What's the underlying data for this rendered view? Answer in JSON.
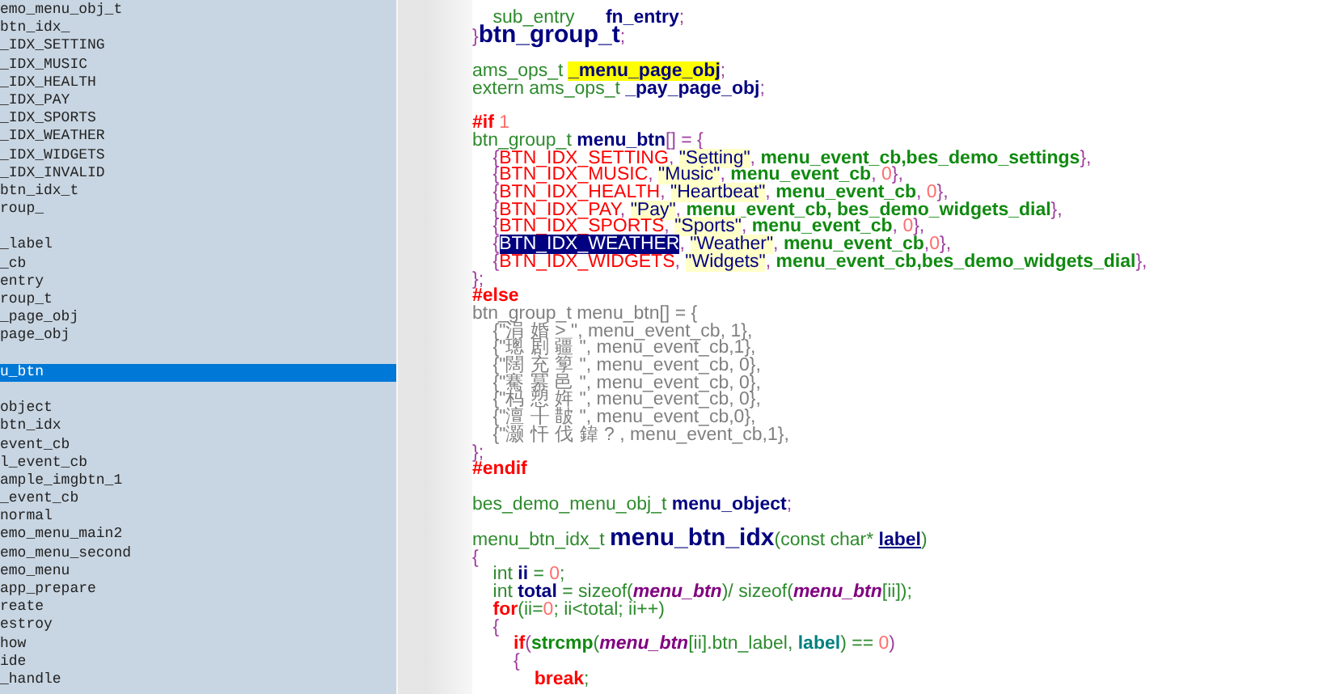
{
  "symbol_list": [
    {
      "text": "emo_menu_obj_t",
      "selected": false
    },
    {
      "text": "btn_idx_",
      "selected": false
    },
    {
      "text": "_IDX_SETTING",
      "selected": false
    },
    {
      "text": "_IDX_MUSIC",
      "selected": false
    },
    {
      "text": "_IDX_HEALTH",
      "selected": false
    },
    {
      "text": "_IDX_PAY",
      "selected": false
    },
    {
      "text": "_IDX_SPORTS",
      "selected": false
    },
    {
      "text": "_IDX_WEATHER",
      "selected": false
    },
    {
      "text": "_IDX_WIDGETS",
      "selected": false
    },
    {
      "text": "_IDX_INVALID",
      "selected": false
    },
    {
      "text": "btn_idx_t",
      "selected": false
    },
    {
      "text": "roup_",
      "selected": false
    },
    {
      "text": "_label",
      "selected": false,
      "space_before": true
    },
    {
      "text": "_cb",
      "selected": false
    },
    {
      "text": "entry",
      "selected": false
    },
    {
      "text": "roup_t",
      "selected": false
    },
    {
      "text": "_page_obj",
      "selected": false
    },
    {
      "text": "page_obj",
      "selected": false
    },
    {
      "text": "u_btn",
      "selected": true,
      "space_before": true
    },
    {
      "text": "object",
      "selected": false,
      "space_before": true
    },
    {
      "text": "btn_idx",
      "selected": false
    },
    {
      "text": "event_cb",
      "selected": false
    },
    {
      "text": "l_event_cb",
      "selected": false
    },
    {
      "text": "ample_imgbtn_1",
      "selected": false
    },
    {
      "text": "_event_cb",
      "selected": false
    },
    {
      "text": "normal",
      "selected": false
    },
    {
      "text": "emo_menu_main2",
      "selected": false
    },
    {
      "text": "emo_menu_second",
      "selected": false
    },
    {
      "text": "emo_menu",
      "selected": false
    },
    {
      "text": "app_prepare",
      "selected": false
    },
    {
      "text": "reate",
      "selected": false
    },
    {
      "text": "estroy",
      "selected": false
    },
    {
      "text": "how",
      "selected": false
    },
    {
      "text": "ide",
      "selected": false
    },
    {
      "text": "_handle",
      "selected": false
    }
  ],
  "code_lines": [
    {
      "tokens": [
        {
          "kind": "type",
          "text": "    sub_entry      "
        },
        {
          "kind": "name",
          "text": "fn_entry"
        },
        {
          "kind": "punct",
          "text": ";"
        }
      ]
    },
    {
      "tokens": [
        {
          "kind": "punct",
          "text": "}"
        },
        {
          "kind": "title",
          "text": "btn_group_t"
        },
        {
          "kind": "punct",
          "text": ";"
        }
      ]
    },
    {
      "space_before": true,
      "tokens": [
        {
          "kind": "type",
          "text": "ams_ops_t "
        },
        {
          "kind": "mark",
          "text": "_menu_page_obj"
        },
        {
          "kind": "punct",
          "text": ";"
        }
      ]
    },
    {
      "tokens": [
        {
          "kind": "type",
          "text": "extern ams_ops_t "
        },
        {
          "kind": "name",
          "text": "_pay_page_obj"
        },
        {
          "kind": "punct",
          "text": ";"
        }
      ]
    },
    {
      "space_before": true,
      "tokens": [
        {
          "kind": "kw",
          "text": "#if "
        },
        {
          "kind": "num",
          "text": "1"
        }
      ]
    },
    {
      "tokens": [
        {
          "kind": "type",
          "text": "btn_group_t "
        },
        {
          "kind": "name",
          "text": "menu_btn"
        },
        {
          "kind": "punct",
          "text": "[] = {"
        }
      ]
    },
    {
      "tokens": [
        {
          "kind": "punct",
          "text": "    {"
        },
        {
          "kind": "macro",
          "text": "BTN_IDX_SETTING"
        },
        {
          "kind": "punct",
          "text": ", "
        },
        {
          "kind": "str",
          "text": "\"Setting\""
        },
        {
          "kind": "punct",
          "text": ", "
        },
        {
          "kind": "func",
          "text": "menu_event_cb,bes_demo_settings"
        },
        {
          "kind": "punct",
          "text": "},"
        }
      ]
    },
    {
      "tokens": [
        {
          "kind": "punct",
          "text": "    {"
        },
        {
          "kind": "macro",
          "text": "BTN_IDX_MUSIC"
        },
        {
          "kind": "punct",
          "text": ", "
        },
        {
          "kind": "str",
          "text": "\"Music\""
        },
        {
          "kind": "punct",
          "text": ", "
        },
        {
          "kind": "func",
          "text": "menu_event_cb"
        },
        {
          "kind": "punct",
          "text": ", "
        },
        {
          "kind": "num",
          "text": "0"
        },
        {
          "kind": "punct",
          "text": "},"
        }
      ]
    },
    {
      "tokens": [
        {
          "kind": "punct",
          "text": "    {"
        },
        {
          "kind": "macro",
          "text": "BTN_IDX_HEALTH"
        },
        {
          "kind": "punct",
          "text": ", "
        },
        {
          "kind": "str",
          "text": "\"Heartbeat\""
        },
        {
          "kind": "punct",
          "text": ", "
        },
        {
          "kind": "func",
          "text": "menu_event_cb"
        },
        {
          "kind": "punct",
          "text": ", "
        },
        {
          "kind": "num",
          "text": "0"
        },
        {
          "kind": "punct",
          "text": "},"
        }
      ]
    },
    {
      "tokens": [
        {
          "kind": "punct",
          "text": "    {"
        },
        {
          "kind": "macro",
          "text": "BTN_IDX_PAY"
        },
        {
          "kind": "punct",
          "text": ", "
        },
        {
          "kind": "str",
          "text": "\"Pay\""
        },
        {
          "kind": "punct",
          "text": ", "
        },
        {
          "kind": "func",
          "text": "menu_event_cb, bes_demo_widgets_dial"
        },
        {
          "kind": "punct",
          "text": "},"
        }
      ]
    },
    {
      "tokens": [
        {
          "kind": "punct",
          "text": "    {"
        },
        {
          "kind": "macro",
          "text": "BTN_IDX_SPORTS"
        },
        {
          "kind": "punct",
          "text": ", "
        },
        {
          "kind": "str",
          "text": "\"Sports\""
        },
        {
          "kind": "punct",
          "text": ", "
        },
        {
          "kind": "func",
          "text": "menu_event_cb"
        },
        {
          "kind": "punct",
          "text": ", "
        },
        {
          "kind": "num",
          "text": "0"
        },
        {
          "kind": "punct",
          "text": "},"
        }
      ]
    },
    {
      "tokens": [
        {
          "kind": "punct",
          "text": "    {"
        },
        {
          "kind": "sel",
          "text": "BTN_IDX_WEATHER"
        },
        {
          "kind": "punct",
          "text": ", "
        },
        {
          "kind": "str",
          "text": "\"Weather\""
        },
        {
          "kind": "punct",
          "text": ", "
        },
        {
          "kind": "func",
          "text": "menu_event_cb"
        },
        {
          "kind": "punct",
          "text": ","
        },
        {
          "kind": "num",
          "text": "0"
        },
        {
          "kind": "punct",
          "text": "},"
        }
      ]
    },
    {
      "tokens": [
        {
          "kind": "punct",
          "text": "    {"
        },
        {
          "kind": "macro",
          "text": "BTN_IDX_WIDGETS"
        },
        {
          "kind": "punct",
          "text": ", "
        },
        {
          "kind": "str",
          "text": "\"Widgets\""
        },
        {
          "kind": "punct",
          "text": ", "
        },
        {
          "kind": "func",
          "text": "menu_event_cb,bes_demo_widgets_dial"
        },
        {
          "kind": "punct",
          "text": "},"
        }
      ]
    },
    {
      "tokens": [
        {
          "kind": "punct",
          "text": "};"
        }
      ]
    },
    {
      "tokens": [
        {
          "kind": "kw",
          "text": "#else"
        }
      ]
    },
    {
      "tokens": [
        {
          "kind": "gray",
          "text": "btn_group_t menu_btn[] = {"
        }
      ]
    },
    {
      "tokens": [
        {
          "kind": "gray",
          "text": "    {\"涓 婚 > \", menu_event_cb, 1},"
        }
      ]
    },
    {
      "tokens": [
        {
          "kind": "gray",
          "text": "    {\"璁 剧 疆 \", menu_event_cb,1},"
        }
      ]
    },
    {
      "tokens": [
        {
          "kind": "gray",
          "text": "    {\"闊 充 箰 \", menu_event_cb, 0},"
        }
      ]
    },
    {
      "tokens": [
        {
          "kind": "gray",
          "text": "    {\"騫 冪 邑 \", menu_event_cb, 0},"
        }
      ]
    },
    {
      "tokens": [
        {
          "kind": "gray",
          "text": "    {\"杩 愬 姩 \", menu_event_cb, 0},"
        }
      ]
    },
    {
      "tokens": [
        {
          "kind": "gray",
          "text": "    {\"澶 ╂ 皵 \", menu_event_cb,0},"
        }
      ]
    },
    {
      "tokens": [
        {
          "kind": "gray",
          "text": "    {\"灏 忓 伐 鍏 ? , menu_event_cb,1},"
        }
      ]
    },
    {
      "tokens": [
        {
          "kind": "punct",
          "text": "};"
        }
      ]
    },
    {
      "tokens": [
        {
          "kind": "kw",
          "text": "#endif"
        }
      ]
    },
    {
      "space_before": true,
      "tokens": [
        {
          "kind": "type",
          "text": "bes_demo_menu_obj_t "
        },
        {
          "kind": "name",
          "text": "menu_object"
        },
        {
          "kind": "punct",
          "text": ";"
        }
      ]
    },
    {
      "space_before": true,
      "tokens": [
        {
          "kind": "type",
          "text": "menu_btn_idx_t "
        },
        {
          "kind": "title",
          "text": "menu_btn_idx"
        },
        {
          "kind": "type",
          "text": "(const char* "
        },
        {
          "kind": "arg",
          "text": "label"
        },
        {
          "kind": "type",
          "text": ")"
        }
      ]
    },
    {
      "tokens": [
        {
          "kind": "punct",
          "text": "{"
        }
      ]
    },
    {
      "tokens": [
        {
          "kind": "type",
          "text": "    int "
        },
        {
          "kind": "name",
          "text": "ii"
        },
        {
          "kind": "type",
          "text": " = "
        },
        {
          "kind": "num",
          "text": "0"
        },
        {
          "kind": "type",
          "text": ";"
        }
      ]
    },
    {
      "tokens": [
        {
          "kind": "type",
          "text": "    int "
        },
        {
          "kind": "name",
          "text": "total"
        },
        {
          "kind": "type",
          "text": " = sizeof("
        },
        {
          "kind": "param",
          "text": "menu_btn"
        },
        {
          "kind": "type",
          "text": ")/ sizeof("
        },
        {
          "kind": "param",
          "text": "menu_btn"
        },
        {
          "kind": "type",
          "text": "[ii]);"
        }
      ]
    },
    {
      "tokens": [
        {
          "kind": "kw",
          "text": "    for"
        },
        {
          "kind": "type",
          "text": "(ii="
        },
        {
          "kind": "num",
          "text": "0"
        },
        {
          "kind": "type",
          "text": "; ii<total; ii++)"
        }
      ]
    },
    {
      "tokens": [
        {
          "kind": "punct",
          "text": "    {"
        }
      ]
    },
    {
      "tokens": [
        {
          "kind": "kw",
          "text": "        if"
        },
        {
          "kind": "punct",
          "text": "("
        },
        {
          "kind": "func",
          "text": "strcmp"
        },
        {
          "kind": "type",
          "text": "("
        },
        {
          "kind": "param",
          "text": "menu_btn"
        },
        {
          "kind": "type",
          "text": "[ii].btn_label, "
        },
        {
          "kind": "teal",
          "text": "label"
        },
        {
          "kind": "type",
          "text": ") == "
        },
        {
          "kind": "num",
          "text": "0"
        },
        {
          "kind": "punct",
          "text": ")"
        }
      ]
    },
    {
      "tokens": [
        {
          "kind": "punct",
          "text": "        {"
        }
      ]
    },
    {
      "tokens": [
        {
          "kind": "kw",
          "text": "            break"
        },
        {
          "kind": "type",
          "text": ";"
        }
      ]
    }
  ]
}
